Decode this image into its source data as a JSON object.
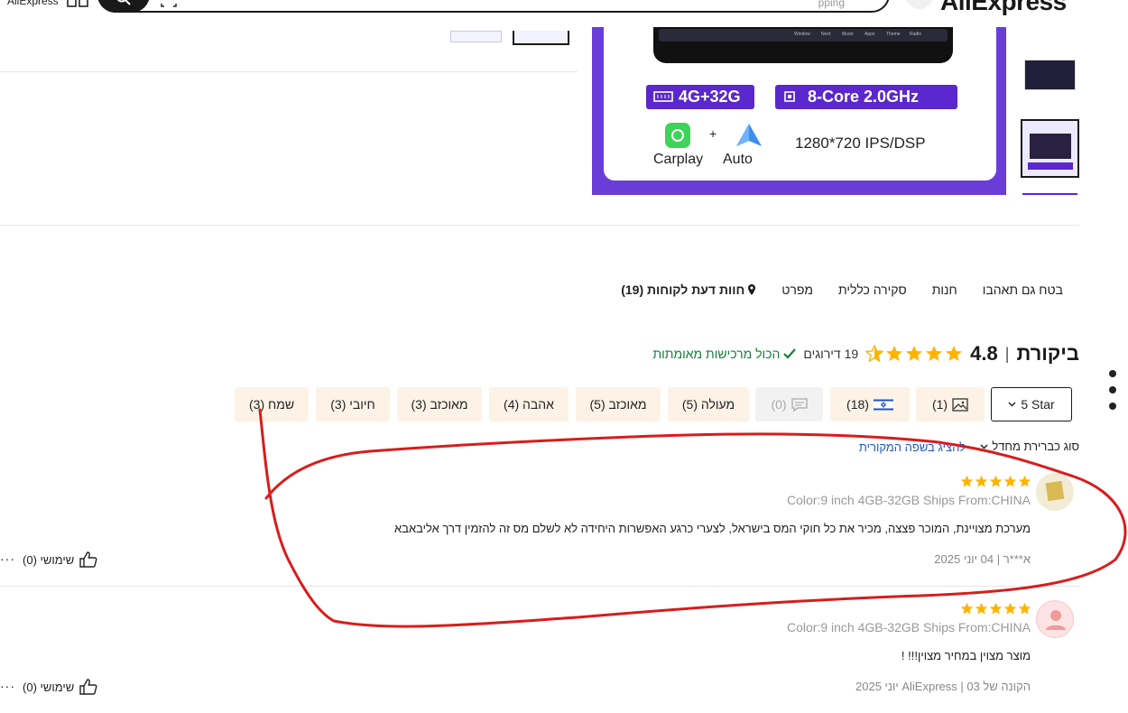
{
  "header": {
    "brand_small": "AliExpress",
    "brand_logo": "AliExpress",
    "search_placeholder": "pping",
    "icons": [
      "grid-icon",
      "search-icon",
      "camera-icon",
      "menu-icon"
    ]
  },
  "product_image": {
    "screen_labels": [
      "Window",
      "Next",
      "Music",
      "Apps",
      "Theme",
      "Radio"
    ],
    "badge_memory": "4G+32G",
    "badge_cpu": "8-Core 2.0GHz",
    "carplay_label": "Carplay",
    "plus": "+",
    "auto_label": "Auto",
    "resolution": "1280*720 IPS/DSP"
  },
  "tabs": [
    {
      "label": "חוות דעת לקוחות (19)",
      "active": true,
      "icon": "location-pin-icon"
    },
    {
      "label": "מפרט",
      "active": false
    },
    {
      "label": "סקירה כללית",
      "active": false
    },
    {
      "label": "חנות",
      "active": false
    },
    {
      "label": "בטח גם תאהבו",
      "active": false
    }
  ],
  "rating": {
    "title": "ביקורת",
    "separator": "|",
    "value": "4.8",
    "stars_filled": 4.8,
    "count_text": "19 דירוגים",
    "verified_text": "הכול מרכישות מאומתות",
    "star_color": "#ffb300",
    "verified_color": "#14803b"
  },
  "filters": {
    "star_select": "5 Star",
    "photos": "(1)",
    "country": "(18)",
    "comments": "(0)",
    "chips": [
      "מעולה (5)",
      "מאוכזב (5)",
      "אהבה (4)",
      "מאוכזב (3)",
      "חיובי (3)",
      "שמח (3)"
    ]
  },
  "sort": {
    "label": "סוג כברירת מחדל",
    "translate_link": "להציג בשפה המקורית"
  },
  "reviews": [
    {
      "stars": 5,
      "meta": "Color:9 inch 4GB-32GB Ships From:CHINA",
      "text": "מערכת מצויינת, המוכר פצצה, מכיר את כל חוקי המס בישראל, לצערי כרגע האפשרות היחידה לא לשלם מס זה להזמין דרך אליבאבא",
      "author_date": "א***ר | 04 יוני 2025",
      "helpful": "שימושי (0)"
    },
    {
      "stars": 5,
      "meta": "Color:9 inch 4GB-32GB Ships From:CHINA",
      "text": "מוצר מצוין במחיר מצוין!!! !",
      "author_date": "הקונה של AliExpress | 03 יוני 2025",
      "helpful": "שימושי (0)"
    }
  ],
  "more": "···",
  "colors": {
    "accent_purple": "#5a28cc",
    "annotation_red": "#d91c1c",
    "chip_bg": "#fdf2e6"
  }
}
